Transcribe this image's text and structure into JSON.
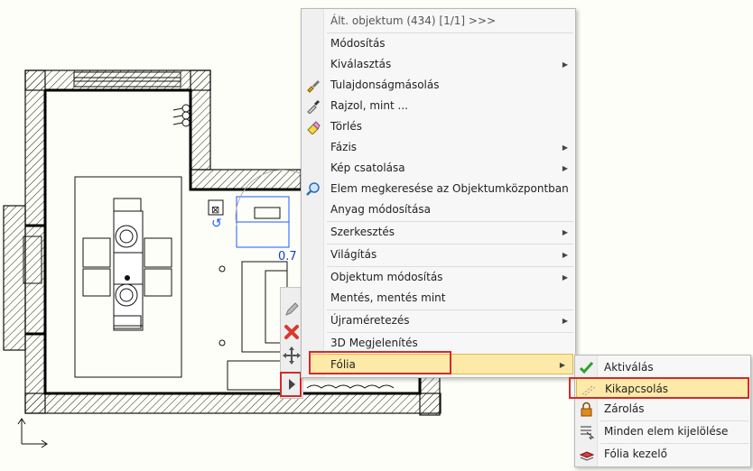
{
  "context_menu": {
    "header": "Ált. objektum (434) [1/1] >>>",
    "items": [
      {
        "label": "Módosítás"
      },
      {
        "label": "Kiválasztás"
      },
      {
        "label": "Tulajdonságmásolás",
        "icon": "brush-icon"
      },
      {
        "label": "Rajzol, mint ...",
        "icon": "eyedropper-icon"
      },
      {
        "label": "Törlés",
        "icon": "eraser-icon"
      },
      {
        "label": "Fázis"
      },
      {
        "label": "Kép csatolása"
      },
      {
        "label": "Elem megkeresése az Objektumközpontban",
        "icon": "search-icon"
      },
      {
        "label": "Anyag módosítása"
      },
      {
        "label": "Szerkesztés"
      },
      {
        "label": "Világítás"
      },
      {
        "label": "Objektum módosítás"
      },
      {
        "label": "Mentés, mentés mint"
      },
      {
        "label": "Újraméretezés"
      },
      {
        "label": "3D Megjelenítés"
      },
      {
        "label": "Fólia"
      }
    ]
  },
  "submenu": {
    "items": [
      {
        "label": "Aktiválás",
        "icon": "checkmark-icon"
      },
      {
        "label": "Kikapcsolás",
        "icon": "layer-off-icon"
      },
      {
        "label": "Zárolás",
        "icon": "lock-icon"
      },
      {
        "label": "Minden elem kijelölése",
        "icon": "select-all-icon"
      },
      {
        "label": "Fólia kezelő",
        "icon": "layer-manager-icon"
      }
    ]
  },
  "drawing": {
    "dimension_text": "0.7"
  },
  "colors": {
    "highlight": "#fde9a8",
    "annotation": "#d42a2a",
    "selection": "#1a5cff"
  }
}
